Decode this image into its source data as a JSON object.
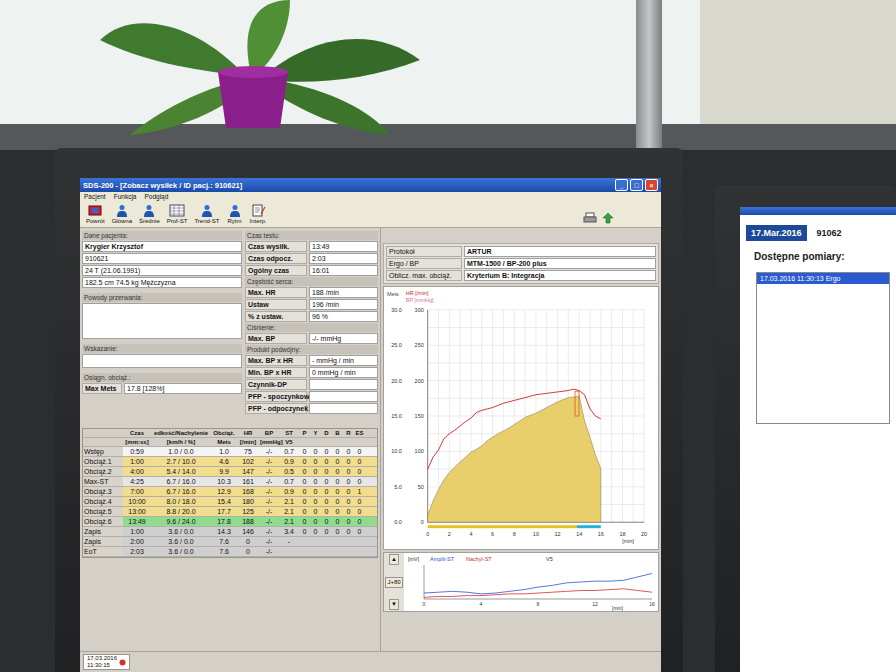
{
  "app_window": {
    "title": "SDS-200 - [Zobacz wysiłek / ID pacj.: 910621]",
    "window_buttons": [
      "_",
      "□",
      "×"
    ]
  },
  "menu": [
    "Pacjent",
    "Funkcja",
    "Podgląd"
  ],
  "toolbar": [
    "Powrót",
    "Główna",
    "Średnie",
    "Prof-ST",
    "Trend-ST",
    "Rytm",
    "Interp."
  ],
  "patient": {
    "heading": "Dane pacjenta:",
    "lines": [
      "Krygier Krzysztof",
      "910621",
      "24 T (21.06.1991)",
      "182.5 cm  74.5 kg  Mężczyzna"
    ]
  },
  "stop_reasons": {
    "heading": "Powody przerwania:"
  },
  "indication": {
    "heading": "Wskazanie:"
  },
  "achieved_load": {
    "heading": "Osiągn. obciąż.:",
    "label": "Max Mets",
    "value": "17.8  [128%]"
  },
  "summary_groups": [
    {
      "heading": "Czas testu:",
      "rows": [
        {
          "label": "Czas wysiłk.",
          "value": "13:49"
        },
        {
          "label": "Czas odpocz.",
          "value": "2:03"
        },
        {
          "label": "Ogólny czas",
          "value": "16:01"
        }
      ]
    },
    {
      "heading": "Częstość serca:",
      "rows": [
        {
          "label": "Max. HR",
          "value": "188 /min"
        },
        {
          "label": "Ustaw",
          "value": "196 /min"
        },
        {
          "label": "% z ustaw.",
          "value": "96 %"
        }
      ]
    },
    {
      "heading": "Ciśnienie:",
      "rows": [
        {
          "label": "Max. BP",
          "value": "-/- mmHg"
        }
      ]
    },
    {
      "heading": "Produkt podwójny:",
      "rows": [
        {
          "label": "Max. BP x HR",
          "value": "- mmHg / min"
        },
        {
          "label": "Min. BP x HR",
          "value": "0 mmHg / min"
        },
        {
          "label": "Czynnik-DP",
          "value": ""
        },
        {
          "label": "PFP - spoczynkow",
          "value": ""
        },
        {
          "label": "PFP - odpoczynek",
          "value": ""
        }
      ]
    }
  ],
  "protocol": [
    {
      "label": "Protokół",
      "value": "ARTUR"
    },
    {
      "label": "Ergo / BP",
      "value": "MTM-1500 / BP-200 plus"
    },
    {
      "label": "Oblicz. max. obciąż.",
      "value": "Kryterium B: Integracja"
    }
  ],
  "stage_table": {
    "columns": [
      {
        "label": "",
        "unit": ""
      },
      {
        "label": "Czas",
        "unit": "[mm:ss]"
      },
      {
        "label": "edkość/Nachylenie",
        "unit": "[km/h / %]"
      },
      {
        "label": "Obciąż.",
        "unit": "Mets"
      },
      {
        "label": "HR",
        "unit": "[/min]"
      },
      {
        "label": "BP",
        "unit": "[mmHg]"
      },
      {
        "label": "ST",
        "unit": "V5"
      },
      {
        "label": "P",
        "unit": ""
      },
      {
        "label": "Y",
        "unit": ""
      },
      {
        "label": "D",
        "unit": ""
      },
      {
        "label": "B",
        "unit": ""
      },
      {
        "label": "R",
        "unit": ""
      },
      {
        "label": "ES",
        "unit": ""
      }
    ],
    "rows": [
      {
        "label": "Wstęp",
        "cells": [
          "0:59",
          "1.0 / 0.0",
          "1.0",
          "75",
          "-/-",
          "0.7",
          "0",
          "0",
          "0",
          "0",
          "0",
          "0"
        ],
        "color": "#f4f4f4"
      },
      {
        "label": "Obciąż.1",
        "cells": [
          "1:00",
          "2.7 / 10.0",
          "4.6",
          "102",
          "-/-",
          "0.9",
          "0",
          "0",
          "0",
          "0",
          "0",
          "0"
        ],
        "color": "#f2dc8e"
      },
      {
        "label": "Obciąż.2",
        "cells": [
          "4:00",
          "5.4 / 14.0",
          "9.9",
          "147",
          "-/-",
          "0.5",
          "0",
          "0",
          "0",
          "0",
          "0",
          "0"
        ],
        "color": "#f2dc8e"
      },
      {
        "label": "Max-ST",
        "cells": [
          "4:25",
          "6.7 / 16.0",
          "10.3",
          "161",
          "-/-",
          "0.7",
          "0",
          "0",
          "0",
          "0",
          "0",
          "0"
        ],
        "color": "#e6e6e6"
      },
      {
        "label": "Obciąż.3",
        "cells": [
          "7:00",
          "6.7 / 16.0",
          "12.9",
          "168",
          "-/-",
          "0.9",
          "0",
          "0",
          "0",
          "0",
          "0",
          "1"
        ],
        "color": "#f2dc8e"
      },
      {
        "label": "Obciąż.4",
        "cells": [
          "10:00",
          "8.0 / 18.0",
          "15.4",
          "180",
          "-/-",
          "2.1",
          "0",
          "0",
          "0",
          "0",
          "0",
          "0"
        ],
        "color": "#f2dc8e"
      },
      {
        "label": "Obciąż.5",
        "cells": [
          "13:00",
          "8.8 / 20.0",
          "17.7",
          "125",
          "-/-",
          "2.1",
          "0",
          "0",
          "0",
          "0",
          "0",
          "0"
        ],
        "color": "#f2dc8e"
      },
      {
        "label": "Obciąż.6",
        "cells": [
          "13:49",
          "9.6 / 24.0",
          "17.8",
          "188",
          "-/-",
          "2.1",
          "0",
          "0",
          "0",
          "0",
          "0",
          "0"
        ],
        "color": "#8fdc8f"
      },
      {
        "label": "Zapis",
        "cells": [
          "1:00",
          "3.6 / 0.0",
          "14.3",
          "146",
          "-/-",
          "3.4",
          "0",
          "0",
          "0",
          "0",
          "0",
          "0"
        ],
        "color": "#cfcfcf"
      },
      {
        "label": "Zapis",
        "cells": [
          "2:00",
          "3.6 / 0.0",
          "7.6",
          "0",
          "-/-",
          "-",
          "",
          "",
          "",
          "",
          "",
          ""
        ],
        "color": "#cfcfcf"
      },
      {
        "label": "EoT",
        "cells": [
          "2:03",
          "3.6 / 0.0",
          "7.6",
          "0",
          "-/-",
          "",
          "",
          "",
          "",
          "",
          "",
          ""
        ],
        "color": "#cfcfcf"
      }
    ]
  },
  "chart": {
    "y_ticks_mets": [
      "0.0",
      "5.0",
      "10.0",
      "15.0",
      "20.0",
      "25.0",
      "30.0"
    ],
    "y_ticks_hr": [
      "0",
      "50",
      "100",
      "150",
      "200",
      "250",
      "300"
    ],
    "x_ticks": [
      "0",
      "2",
      "4",
      "6",
      "8",
      "10",
      "12",
      "14",
      "16",
      "18",
      "20"
    ],
    "x_unit": "[min]",
    "times": [
      0,
      0.5,
      1,
      1.5,
      2,
      2.5,
      3,
      3.5,
      4,
      4.5,
      5,
      5.5,
      6,
      6.5,
      7,
      7.5,
      8,
      8.5,
      9,
      9.5,
      10,
      10.5,
      11,
      11.5,
      12,
      12.5,
      13,
      13.5,
      14,
      14.5,
      15,
      15.5,
      16
    ],
    "series": [
      {
        "name": "Mets",
        "color": "#e9cf6c",
        "values": [
          1,
          3,
          4.6,
          6,
          7,
          7.8,
          8.5,
          9.2,
          9.9,
          10.3,
          10.8,
          11.5,
          12,
          12.5,
          12.9,
          13.3,
          13.8,
          14.3,
          14.8,
          15.1,
          15.4,
          15.8,
          16.2,
          16.6,
          17,
          17.3,
          17.6,
          17.7,
          17.8,
          14.3,
          12,
          9.5,
          7.6
        ]
      },
      {
        "name": "HR [/min]",
        "color": "#d02020",
        "values": [
          75,
          92,
          102,
          118,
          125,
          130,
          136,
          142,
          147,
          155,
          158,
          160,
          162,
          165,
          168,
          170,
          172,
          174,
          176,
          178,
          180,
          181,
          182,
          183,
          184,
          185,
          186,
          188,
          186,
          180,
          160,
          150,
          146
        ]
      },
      {
        "name": "BP [mmHg]",
        "color": "#e070a0",
        "values": []
      }
    ],
    "marker": 13.8,
    "phases": [
      {
        "to": 13.8,
        "color": "#e8c020"
      },
      {
        "to": 16,
        "color": "#2ab0d8"
      }
    ]
  },
  "st_chart": {
    "unit": "[mV]",
    "lead": "V5",
    "x_ticks": [
      "0",
      "4",
      "8",
      "12",
      "16"
    ],
    "x_unit": "[min]",
    "times": [
      0,
      1,
      2,
      3,
      4,
      5,
      6,
      7,
      8,
      9,
      10,
      11,
      12,
      13,
      14,
      15,
      16
    ],
    "series": [
      {
        "name": "Amplit-ST",
        "color": "#3050d0",
        "values": [
          0.7,
          0.8,
          0.9,
          0.8,
          0.6,
          0.7,
          0.9,
          1.1,
          1.4,
          1.6,
          1.9,
          2.0,
          2.1,
          2.1,
          2.2,
          2.6,
          3.0
        ]
      },
      {
        "name": "Nachyl-ST",
        "color": "#d03030",
        "values": [
          0.2,
          0.3,
          0.3,
          0.4,
          0.4,
          0.5,
          0.6,
          0.6,
          0.7,
          0.8,
          0.9,
          1.0,
          1.0,
          1.1,
          1.2,
          1.0,
          0.8
        ]
      }
    ],
    "buttons": [
      "▲",
      "J+80",
      "▼"
    ]
  },
  "taskbar": {
    "tab": [
      "17.03.2016",
      "11:30:15"
    ]
  },
  "second_monitor": {
    "date": "17.Mar.2016",
    "id": "91062",
    "heading": "Dostępne pomiary:",
    "items": [
      {
        "label": "17.03.2016 11:30:13  Ergo",
        "selected": true
      }
    ]
  }
}
